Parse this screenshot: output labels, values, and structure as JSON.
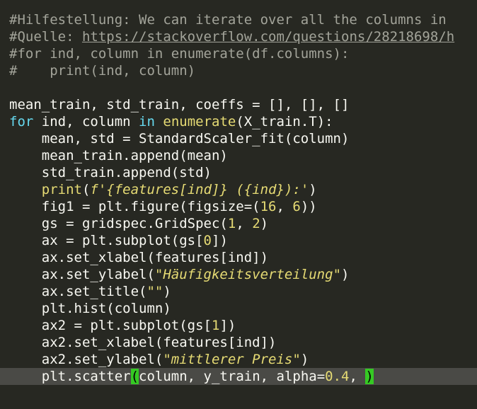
{
  "colors": {
    "background": "#272822",
    "current_line": "#4a4a46",
    "default": "#f8f8f2",
    "comment": "#a3a49a",
    "keyword": "#66d9ef",
    "builtin": "#e6db74",
    "string": "#e6db74",
    "number": "#e6db74",
    "bracket_match_bg": "#35c923",
    "bracket_match_fg": "#000000"
  },
  "code_lines": [
    [
      {
        "t": "#Hilfestellung: We can iterate over all the columns in",
        "c": "comment"
      }
    ],
    [
      {
        "t": "#Quelle: ",
        "c": "comment"
      },
      {
        "t": "https://stackoverflow.com/questions/28218698/h",
        "c": "comment",
        "u": true
      }
    ],
    [
      {
        "t": "#for ind, column in enumerate(df.columns):",
        "c": "comment"
      }
    ],
    [
      {
        "t": "#    print(ind, column)",
        "c": "comment"
      }
    ],
    [],
    [
      {
        "t": "mean_train, std_train, coeffs = [], [], []",
        "c": "default"
      }
    ],
    [
      {
        "t": "for",
        "c": "keyword"
      },
      {
        "t": " ind, column ",
        "c": "default"
      },
      {
        "t": "in",
        "c": "keyword"
      },
      {
        "t": " ",
        "c": "default"
      },
      {
        "t": "enumerate",
        "c": "builtin"
      },
      {
        "t": "(X_train.T):",
        "c": "default"
      }
    ],
    [
      {
        "t": "    mean, std = StandardScaler_fit(column)",
        "c": "default"
      }
    ],
    [
      {
        "t": "    mean_train.append(mean)",
        "c": "default"
      }
    ],
    [
      {
        "t": "    std_train.append(std)",
        "c": "default"
      }
    ],
    [
      {
        "t": "    ",
        "c": "default"
      },
      {
        "t": "print",
        "c": "builtin"
      },
      {
        "t": "(",
        "c": "default"
      },
      {
        "t": "f'{features[ind]} ({ind}):'",
        "c": "string",
        "i": true
      },
      {
        "t": ")",
        "c": "default"
      }
    ],
    [
      {
        "t": "    fig1 = plt.figure(figsize=(",
        "c": "default"
      },
      {
        "t": "16",
        "c": "number"
      },
      {
        "t": ", ",
        "c": "default"
      },
      {
        "t": "6",
        "c": "number"
      },
      {
        "t": "))",
        "c": "default"
      }
    ],
    [
      {
        "t": "    gs = gridspec.GridSpec(",
        "c": "default"
      },
      {
        "t": "1",
        "c": "number"
      },
      {
        "t": ", ",
        "c": "default"
      },
      {
        "t": "2",
        "c": "number"
      },
      {
        "t": ")",
        "c": "default"
      }
    ],
    [
      {
        "t": "    ax = plt.subplot(gs[",
        "c": "default"
      },
      {
        "t": "0",
        "c": "number"
      },
      {
        "t": "])",
        "c": "default"
      }
    ],
    [
      {
        "t": "    ax.set_xlabel(features[ind])",
        "c": "default"
      }
    ],
    [
      {
        "t": "    ax.set_ylabel(",
        "c": "default"
      },
      {
        "t": "\"Häufigkeitsverteilung\"",
        "c": "string",
        "i": true
      },
      {
        "t": ")",
        "c": "default"
      }
    ],
    [
      {
        "t": "    ax.set_title(",
        "c": "default"
      },
      {
        "t": "\"\"",
        "c": "string",
        "i": true
      },
      {
        "t": ")",
        "c": "default"
      }
    ],
    [
      {
        "t": "    plt.hist(column)",
        "c": "default"
      }
    ],
    [
      {
        "t": "    ax2 = plt.subplot(gs[",
        "c": "default"
      },
      {
        "t": "1",
        "c": "number"
      },
      {
        "t": "])",
        "c": "default"
      }
    ],
    [
      {
        "t": "    ax2.set_xlabel(features[ind])",
        "c": "default"
      }
    ],
    [
      {
        "t": "    ax2.set_ylabel(",
        "c": "default"
      },
      {
        "t": "\"mittlerer Preis\"",
        "c": "string",
        "i": true
      },
      {
        "t": ")",
        "c": "default"
      }
    ],
    [
      {
        "t": "    plt.scatter",
        "c": "default"
      },
      {
        "t": "(",
        "c": "default",
        "m": true
      },
      {
        "t": "column, y_train, alpha=",
        "c": "default"
      },
      {
        "t": "0.4",
        "c": "number"
      },
      {
        "t": ", ",
        "c": "default"
      },
      {
        "t": ")",
        "c": "default",
        "m": true
      }
    ]
  ],
  "current_line_index": 21
}
